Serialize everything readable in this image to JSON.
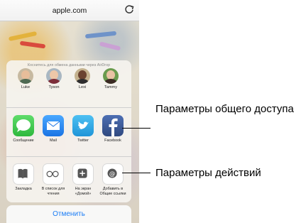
{
  "browser": {
    "url": "apple.com",
    "reload_icon": "reload-icon"
  },
  "share_sheet": {
    "airdrop_hint": "Коснитесь для обмена данными через AirDrop",
    "people": [
      {
        "name": "Luke"
      },
      {
        "name": "Tyson"
      },
      {
        "name": "Lexi"
      },
      {
        "name": "Tammy"
      }
    ],
    "share_apps": [
      {
        "label": "Сообщение",
        "icon": "messages-icon",
        "color": "#3fc94b"
      },
      {
        "label": "Mail",
        "icon": "mail-icon",
        "color": "#2a8cf0"
      },
      {
        "label": "Twitter",
        "icon": "twitter-icon",
        "color": "#2fa9e8"
      },
      {
        "label": "Facebook",
        "icon": "facebook-icon",
        "color": "#3b5998"
      }
    ],
    "actions": [
      {
        "label": "Закладка",
        "icon": "bookmark-icon"
      },
      {
        "label": "В список для чтения",
        "icon": "reading-list-icon"
      },
      {
        "label": "На экран «Домой»",
        "icon": "add-to-home-icon"
      },
      {
        "label": "Добавить в Общие ссылки",
        "icon": "shared-links-icon"
      }
    ],
    "cancel_label": "Отменить"
  },
  "callouts": {
    "sharing": "Параметры общего доступа",
    "actions": "Параметры действий"
  }
}
